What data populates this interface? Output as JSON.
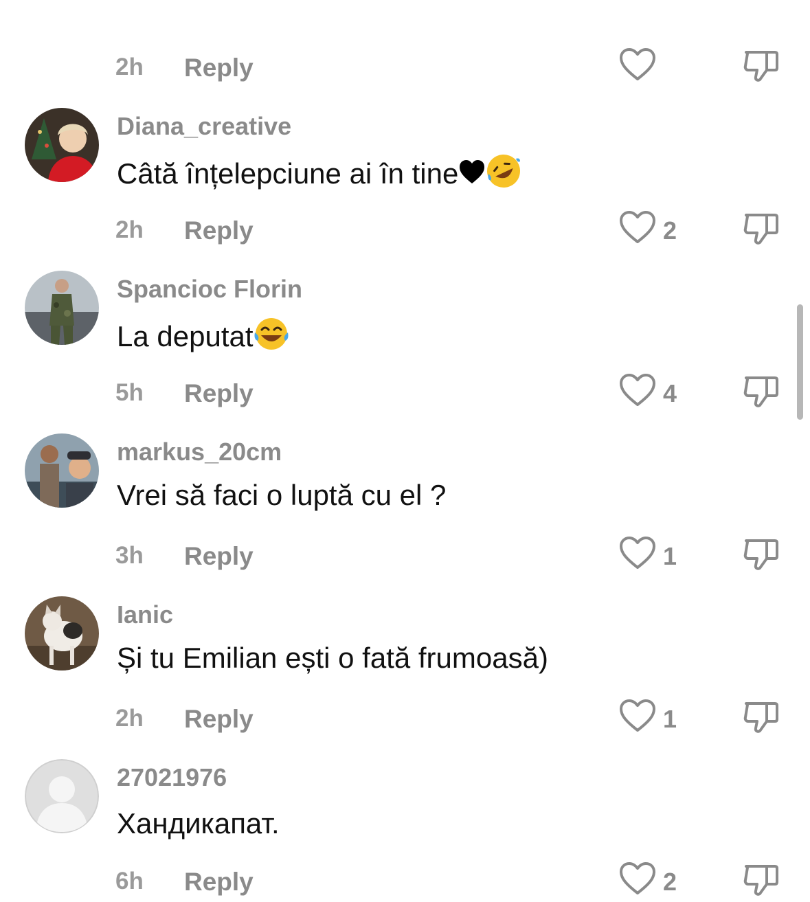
{
  "comments": [
    {
      "username": "",
      "text": "",
      "time": "2h",
      "reply_label": "Reply",
      "likes": ""
    },
    {
      "username": "Diana_creative",
      "text": "Câtă înțelepciune ai în tine",
      "text_icons": [
        "black-heart-icon",
        "rolling-laughing-emoji"
      ],
      "time": "2h",
      "reply_label": "Reply",
      "likes": "2"
    },
    {
      "username": "Spancioc Florin",
      "text": "La deputat",
      "text_icons": [
        "tears-of-joy-emoji"
      ],
      "time": "5h",
      "reply_label": "Reply",
      "likes": "4"
    },
    {
      "username": "markus_20cm",
      "text": "Vrei să faci o luptă cu el ?",
      "time": "3h",
      "reply_label": "Reply",
      "likes": "1"
    },
    {
      "username": "Ianic",
      "text": "Și tu Emilian ești o fată frumoasă)",
      "time": "2h",
      "reply_label": "Reply",
      "likes": "1"
    },
    {
      "username": "27021976",
      "text": "Хандикапат.",
      "time": "6h",
      "reply_label": "Reply",
      "likes": "2"
    }
  ],
  "icons": {
    "like": "heart-outline-icon",
    "dislike": "thumbs-down-outline-icon"
  },
  "colors": {
    "muted_text": "#8a8a8a",
    "comment_text": "#111111",
    "background": "#ffffff"
  }
}
